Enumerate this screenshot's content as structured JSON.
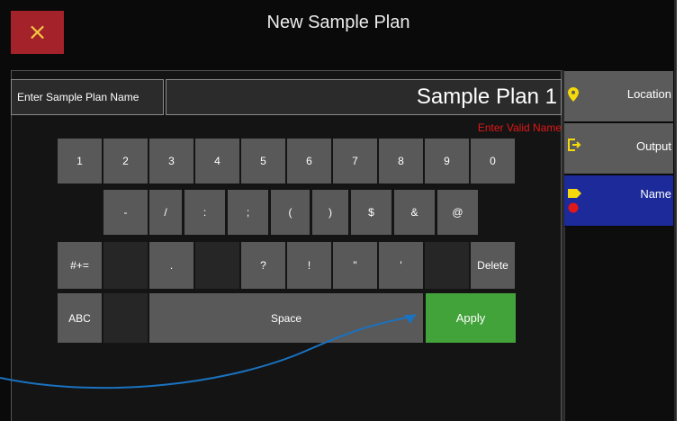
{
  "header": {
    "title": "New Sample Plan",
    "close_icon": "×"
  },
  "name_field": {
    "label": "Enter Sample Plan Name",
    "value": "Sample Plan 1",
    "error": "Enter Valid Name"
  },
  "keyboard": {
    "row1": [
      "1",
      "2",
      "3",
      "4",
      "5",
      "6",
      "7",
      "8",
      "9",
      "0"
    ],
    "row2": [
      "-",
      "/",
      ":",
      ";",
      "(",
      ")",
      "$",
      "&",
      "@"
    ],
    "row3": [
      "#+=",
      "",
      ".",
      "",
      "?",
      "!",
      "\"",
      "'",
      "",
      "Delete"
    ],
    "row4": [
      "ABC",
      "",
      "Space",
      "Apply"
    ]
  },
  "sidebar": {
    "items": [
      {
        "label": "Location",
        "icon": "location-pin-icon"
      },
      {
        "label": "Output",
        "icon": "output-icon"
      },
      {
        "label": "Name",
        "icon": "name-tag-icon"
      }
    ]
  },
  "colors": {
    "accent_yellow": "#f5d90a",
    "close_red": "#a4222a",
    "apply_green": "#43a33b",
    "active_blue": "#1c2a9a",
    "error_red": "#e01818"
  }
}
